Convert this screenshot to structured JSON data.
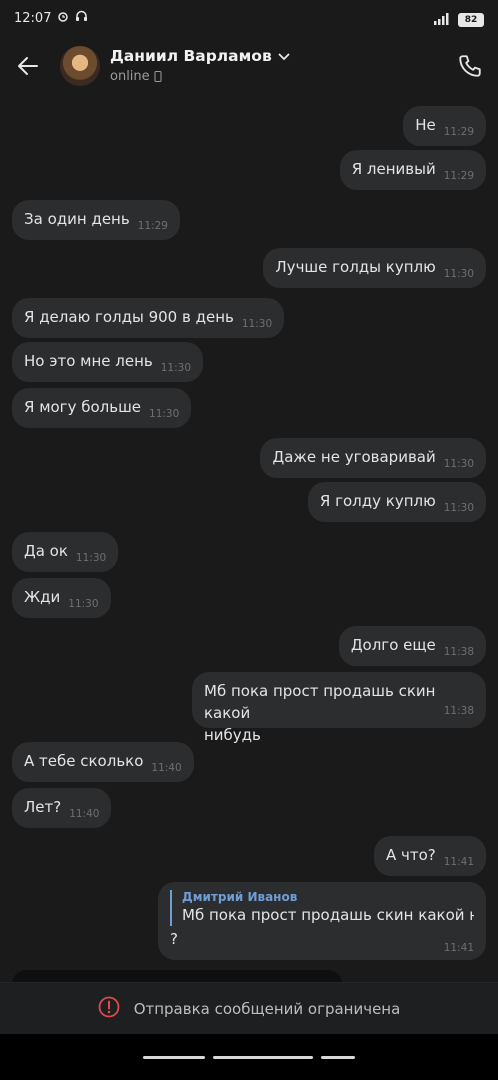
{
  "status_bar": {
    "time": "12:07",
    "battery": "82"
  },
  "header": {
    "contact_name": "Даниил Варламов",
    "contact_status": "online"
  },
  "messages": [
    {
      "text": "Не",
      "time": "11:29",
      "dir": "out"
    },
    {
      "text": "Я ленивый",
      "time": "11:29",
      "dir": "out"
    },
    {
      "text": "За один день",
      "time": "11:29",
      "dir": "in"
    },
    {
      "text": "Лучше голды куплю",
      "time": "11:30",
      "dir": "out"
    },
    {
      "text": "Я делаю голды 900 в день",
      "time": "11:30",
      "dir": "in"
    },
    {
      "text": "Но это мне лень",
      "time": "11:30",
      "dir": "in"
    },
    {
      "text": "Я могу больше",
      "time": "11:30",
      "dir": "in"
    },
    {
      "text": "Даже не уговаривай",
      "time": "11:30",
      "dir": "out"
    },
    {
      "text": "Я голду куплю",
      "time": "11:30",
      "dir": "out"
    },
    {
      "text": "Да ок",
      "time": "11:30",
      "dir": "in"
    },
    {
      "text": "Жди",
      "time": "11:30",
      "dir": "in"
    },
    {
      "text": "Долго еще",
      "time": "11:38",
      "dir": "out"
    },
    {
      "text": "Мб пока прост продашь скин какой нибудь",
      "line1": "Мб пока прост продашь скин какой",
      "line2": "нибудь",
      "time": "11:38",
      "dir": "out"
    },
    {
      "text": "А тебе сколько",
      "time": "11:40",
      "dir": "in"
    },
    {
      "text": "Лет?",
      "time": "11:40",
      "dir": "in"
    },
    {
      "text": "А что?",
      "time": "11:41",
      "dir": "out"
    }
  ],
  "reply": {
    "author": "Дмитрий Иванов",
    "quoted": "Мб пока прост продашь скин какой ни...",
    "text": "?",
    "time": "11:41"
  },
  "restricted": {
    "text": "Отправка сообщений ограничена"
  },
  "colors": {
    "background": "#1a1a1b",
    "bubble": "#2c2d2e",
    "accent": "#6f9ed6",
    "warning": "#e04a4a"
  }
}
